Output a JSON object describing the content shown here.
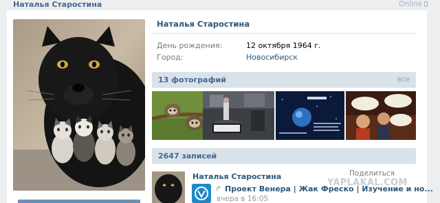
{
  "topbar": {
    "name": "Наталья Старостина",
    "status": "Online"
  },
  "profile": {
    "name": "Наталья Старостина",
    "info": [
      {
        "label": "День рождения:",
        "value": "12 октября 1964 г."
      },
      {
        "label": "Город:",
        "value": "Новосибирск"
      }
    ]
  },
  "photos": {
    "title": "13 фотографий",
    "all_link": "все"
  },
  "wall": {
    "title": "2647 записей",
    "post": {
      "author": "Наталья Старостина",
      "share": "Поделиться",
      "repost_title": "Проект Венера | Жак Фреско | Изучение и но...",
      "time": "вчера в 16:05"
    }
  },
  "watermark": "YAPLAKAL.COM"
}
